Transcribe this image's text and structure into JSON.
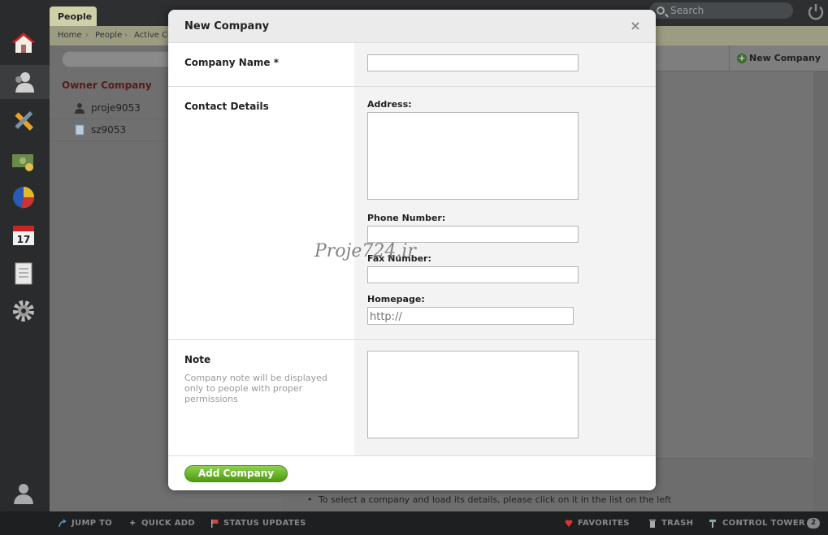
{
  "topbar": {
    "tab": "People",
    "search_placeholder": "Search"
  },
  "breadcrumb": [
    "Home",
    "People",
    "Active Co"
  ],
  "left_pane": {
    "group": "Owner Company",
    "items": [
      {
        "label": "proje9053",
        "icon": "person-icon"
      },
      {
        "label": "sz9053",
        "icon": "document-icon"
      }
    ]
  },
  "right_pane": {
    "new_company_label": "New Company",
    "hint": "To select a company and load its details, please click on it in the list on the left"
  },
  "bottombar": {
    "jump_to": "JUMP TO",
    "quick_add": "QUICK ADD",
    "status_updates": "STATUS UPDATES",
    "favorites": "FAVORITES",
    "trash": "TRASH",
    "control_tower": "CONTROL TOWER",
    "control_tower_count": "2"
  },
  "modal": {
    "title": "New Company",
    "company_name_label": "Company Name *",
    "contact_details_label": "Contact Details",
    "address_label": "Address:",
    "phone_label": "Phone Number:",
    "fax_label": "Fax Number:",
    "homepage_label": "Homepage:",
    "homepage_placeholder": "http://",
    "note_label": "Note",
    "note_help": "Company note will be displayed only to people with proper permissions",
    "submit_label": "Add Company",
    "company_name_value": "",
    "address_value": "",
    "phone_value": "",
    "fax_value": "",
    "note_value": ""
  },
  "watermark": "Proje724.ir",
  "colors": {
    "accent_green": "#4e9a12",
    "owner_company_red": "#5a1a1a",
    "tab_bg": "#cfd0a8"
  }
}
